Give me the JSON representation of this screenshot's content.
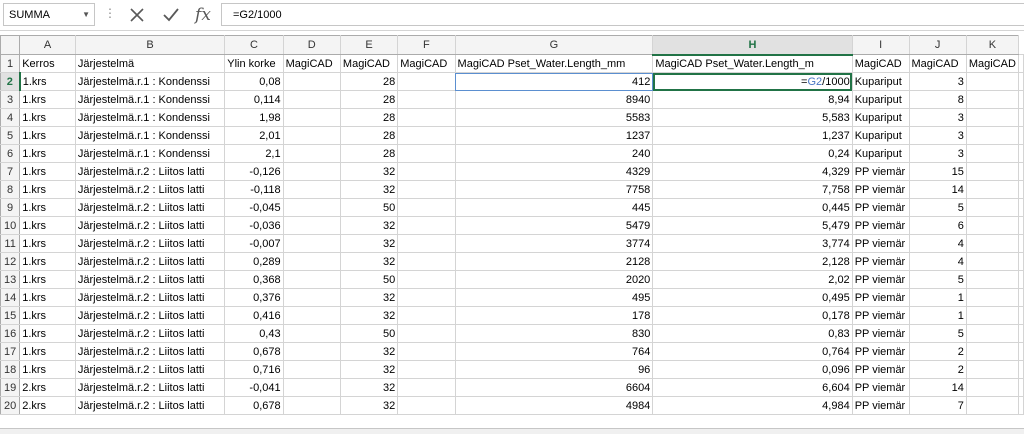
{
  "formula_bar": {
    "name_box": "SUMMA",
    "cancel_icon": "close-icon",
    "enter_icon": "check-icon",
    "fx_label": "fx",
    "formula": "=G2/1000"
  },
  "columns": [
    "A",
    "B",
    "C",
    "D",
    "E",
    "F",
    "G",
    "H",
    "I",
    "J",
    "K"
  ],
  "selected_column": "H",
  "active_cell": "H2",
  "active_formula_parts": {
    "eq": "=",
    "ref": "G2",
    "rest": "/1000"
  },
  "rows": [
    {
      "n": "1",
      "cells": [
        "Kerros",
        "Järjestelmä",
        "Ylin korke",
        "MagiCAD",
        "MagiCAD",
        "MagiCAD",
        "MagiCAD Pset_Water.Length_mm",
        "MagiCAD Pset_Water.Length_m",
        "MagiCAD",
        "MagiCAD",
        "MagiCAD"
      ]
    },
    {
      "n": "2",
      "cells": [
        "1.krs",
        "Järjestelmä.r.1 : Kondenssi",
        "0,08",
        "",
        "28",
        "",
        "412",
        "",
        "Kupariput",
        "3",
        ""
      ]
    },
    {
      "n": "3",
      "cells": [
        "1.krs",
        "Järjestelmä.r.1 : Kondenssi",
        "0,114",
        "",
        "28",
        "",
        "8940",
        "8,94",
        "Kupariput",
        "8",
        ""
      ]
    },
    {
      "n": "4",
      "cells": [
        "1.krs",
        "Järjestelmä.r.1 : Kondenssi",
        "1,98",
        "",
        "28",
        "",
        "5583",
        "5,583",
        "Kupariput",
        "3",
        ""
      ]
    },
    {
      "n": "5",
      "cells": [
        "1.krs",
        "Järjestelmä.r.1 : Kondenssi",
        "2,01",
        "",
        "28",
        "",
        "1237",
        "1,237",
        "Kupariput",
        "3",
        ""
      ]
    },
    {
      "n": "6",
      "cells": [
        "1.krs",
        "Järjestelmä.r.1 : Kondenssi",
        "2,1",
        "",
        "28",
        "",
        "240",
        "0,24",
        "Kupariput",
        "3",
        ""
      ]
    },
    {
      "n": "7",
      "cells": [
        "1.krs",
        "Järjestelmä.r.2 : Liitos latti",
        "-0,126",
        "",
        "32",
        "",
        "4329",
        "4,329",
        "PP viemär",
        "15",
        ""
      ]
    },
    {
      "n": "8",
      "cells": [
        "1.krs",
        "Järjestelmä.r.2 : Liitos latti",
        "-0,118",
        "",
        "32",
        "",
        "7758",
        "7,758",
        "PP viemär",
        "14",
        ""
      ]
    },
    {
      "n": "9",
      "cells": [
        "1.krs",
        "Järjestelmä.r.2 : Liitos latti",
        "-0,045",
        "",
        "50",
        "",
        "445",
        "0,445",
        "PP viemär",
        "5",
        ""
      ]
    },
    {
      "n": "10",
      "cells": [
        "1.krs",
        "Järjestelmä.r.2 : Liitos latti",
        "-0,036",
        "",
        "32",
        "",
        "5479",
        "5,479",
        "PP viemär",
        "6",
        ""
      ]
    },
    {
      "n": "11",
      "cells": [
        "1.krs",
        "Järjestelmä.r.2 : Liitos latti",
        "-0,007",
        "",
        "32",
        "",
        "3774",
        "3,774",
        "PP viemär",
        "4",
        ""
      ]
    },
    {
      "n": "12",
      "cells": [
        "1.krs",
        "Järjestelmä.r.2 : Liitos latti",
        "0,289",
        "",
        "32",
        "",
        "2128",
        "2,128",
        "PP viemär",
        "4",
        ""
      ]
    },
    {
      "n": "13",
      "cells": [
        "1.krs",
        "Järjestelmä.r.2 : Liitos latti",
        "0,368",
        "",
        "50",
        "",
        "2020",
        "2,02",
        "PP viemär",
        "5",
        ""
      ]
    },
    {
      "n": "14",
      "cells": [
        "1.krs",
        "Järjestelmä.r.2 : Liitos latti",
        "0,376",
        "",
        "32",
        "",
        "495",
        "0,495",
        "PP viemär",
        "1",
        ""
      ]
    },
    {
      "n": "15",
      "cells": [
        "1.krs",
        "Järjestelmä.r.2 : Liitos latti",
        "0,416",
        "",
        "32",
        "",
        "178",
        "0,178",
        "PP viemär",
        "1",
        ""
      ]
    },
    {
      "n": "16",
      "cells": [
        "1.krs",
        "Järjestelmä.r.2 : Liitos latti",
        "0,43",
        "",
        "50",
        "",
        "830",
        "0,83",
        "PP viemär",
        "5",
        ""
      ]
    },
    {
      "n": "17",
      "cells": [
        "1.krs",
        "Järjestelmä.r.2 : Liitos latti",
        "0,678",
        "",
        "32",
        "",
        "764",
        "0,764",
        "PP viemär",
        "2",
        ""
      ]
    },
    {
      "n": "18",
      "cells": [
        "1.krs",
        "Järjestelmä.r.2 : Liitos latti",
        "0,716",
        "",
        "32",
        "",
        "96",
        "0,096",
        "PP viemär",
        "2",
        ""
      ]
    },
    {
      "n": "19",
      "cells": [
        "2.krs",
        "Järjestelmä.r.2 : Liitos latti",
        "-0,041",
        "",
        "32",
        "",
        "6604",
        "6,604",
        "PP viemär",
        "14",
        ""
      ]
    },
    {
      "n": "20",
      "cells": [
        "2.krs",
        "Järjestelmä.r.2 : Liitos latti",
        "0,678",
        "",
        "32",
        "",
        "4984",
        "4,984",
        "PP viemär",
        "7",
        ""
      ]
    }
  ],
  "colors": {
    "accent": "#217346",
    "reference": "#4a77c4",
    "grid": "#d4d4d4"
  }
}
